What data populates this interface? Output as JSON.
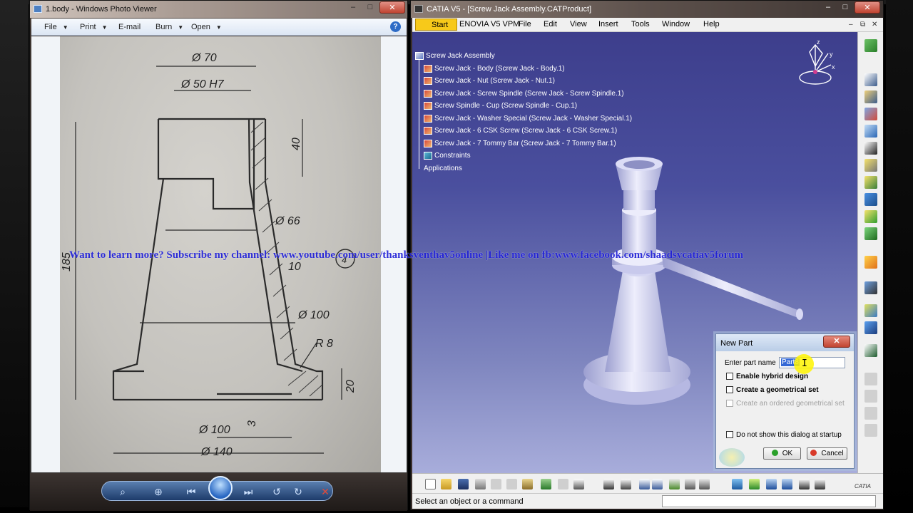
{
  "photo_viewer": {
    "title": "1.body - Windows Photo Viewer",
    "menu": {
      "file": "File",
      "print": "Print",
      "email": "E-mail",
      "burn": "Burn",
      "open": "Open",
      "help": "?"
    },
    "window_controls": {
      "minimize": "–",
      "maximize": "□",
      "close": "✕"
    },
    "drawing": {
      "dim_top_dia": "Ø 70",
      "dim_bore": "Ø 50 H7",
      "dim_depth": "40",
      "dim_total_height": "185",
      "dim_mid_dia": "Ø 66",
      "dim_wall": "10",
      "dim_lower_dia": "Ø 100",
      "dim_fillet": "R 8",
      "dim_base_height": "20",
      "dim_recess_depth": "3",
      "dim_base_inner": "Ø 100",
      "dim_base_outer": "Ø 140",
      "circled_note": "4"
    }
  },
  "catia": {
    "title": "CATIA V5 - [Screw Jack Assembly.CATProduct]",
    "window_controls": {
      "minimize": "–",
      "maximize": "□",
      "close": "✕"
    },
    "menu": {
      "start": "Start",
      "enovia": "ENOVIA V5 VPM",
      "file": "File",
      "edit": "Edit",
      "view": "View",
      "insert": "Insert",
      "tools": "Tools",
      "window": "Window",
      "help": "Help"
    },
    "mdi_controls": {
      "minimize": "–",
      "restore": "⧉",
      "close": "✕"
    },
    "tree": {
      "root": "Screw Jack Assembly",
      "items": [
        "Screw Jack - Body (Screw Jack - Body.1)",
        "Screw Jack - Nut (Screw Jack - Nut.1)",
        "Screw Jack - Screw Spindle (Screw Jack - Screw Spindle.1)",
        "Screw Spindle - Cup (Screw Spindle - Cup.1)",
        "Screw Jack - Washer Special (Screw Jack - Washer Special.1)",
        "Screw Jack - 6 CSK Screw (Screw Jack - 6 CSK Screw.1)",
        "Screw Jack - 7 Tommy Bar (Screw Jack - 7 Tommy Bar.1)"
      ],
      "constraints": "Constraints",
      "applications": "Applications"
    },
    "compass": {
      "x": "x",
      "y": "y",
      "z": "z"
    },
    "status": "Select an object or a command",
    "logo": "CATIA"
  },
  "dialog": {
    "title": "New Part",
    "close": "✕",
    "part_name_label": "Enter part name",
    "part_name_value": "Part8",
    "enable_hybrid": "Enable hybrid design",
    "create_geo_set": "Create a geometrical set",
    "create_ordered_geo_set": "Create an ordered geometrical set",
    "do_not_show": "Do not show this dialog at startup",
    "ok": "OK",
    "cancel": "Cancel"
  },
  "overlay": {
    "text": "Want to learn more? Subscribe my channel: www.youtube.com/user/thanksventhav5online |Like me on fb:www.facebook.com/shaadsvcatiav5forum"
  },
  "colors": {
    "catia_start_button": "#f7c91a",
    "viewport_top": "#3d3e8c",
    "viewport_bottom": "#a8addb",
    "overlay_text": "#1f1fd6",
    "selection": "#3368d6"
  }
}
